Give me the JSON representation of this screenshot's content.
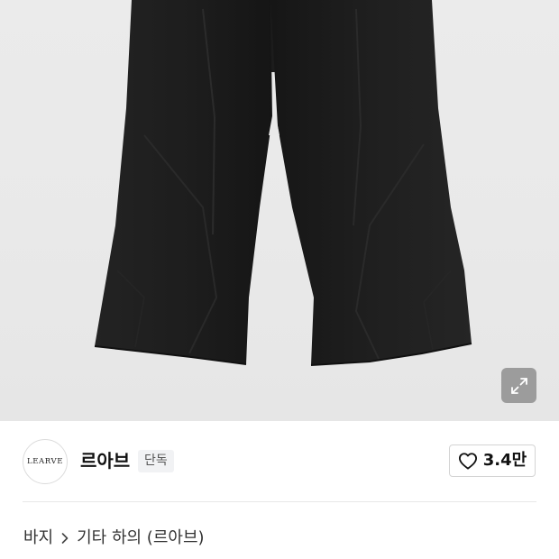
{
  "hero": {
    "image_alt": "black wide-leg pants",
    "expand_icon": "expand-arrows-icon"
  },
  "brand": {
    "logo_text": "LEARVE",
    "name": "르아브",
    "badge": "단독",
    "like_icon": "heart-outline-icon",
    "like_count": "3.4만"
  },
  "breadcrumb": {
    "items": [
      "바지",
      "기타 하의 (르아브)"
    ],
    "separator_icon": "chevron-right-icon"
  },
  "colors": {
    "hero_background": "#e9e9e9",
    "product_black": "#1f1f1f",
    "badge_background": "#f1f2f4",
    "divider": "#e8e8e8"
  }
}
